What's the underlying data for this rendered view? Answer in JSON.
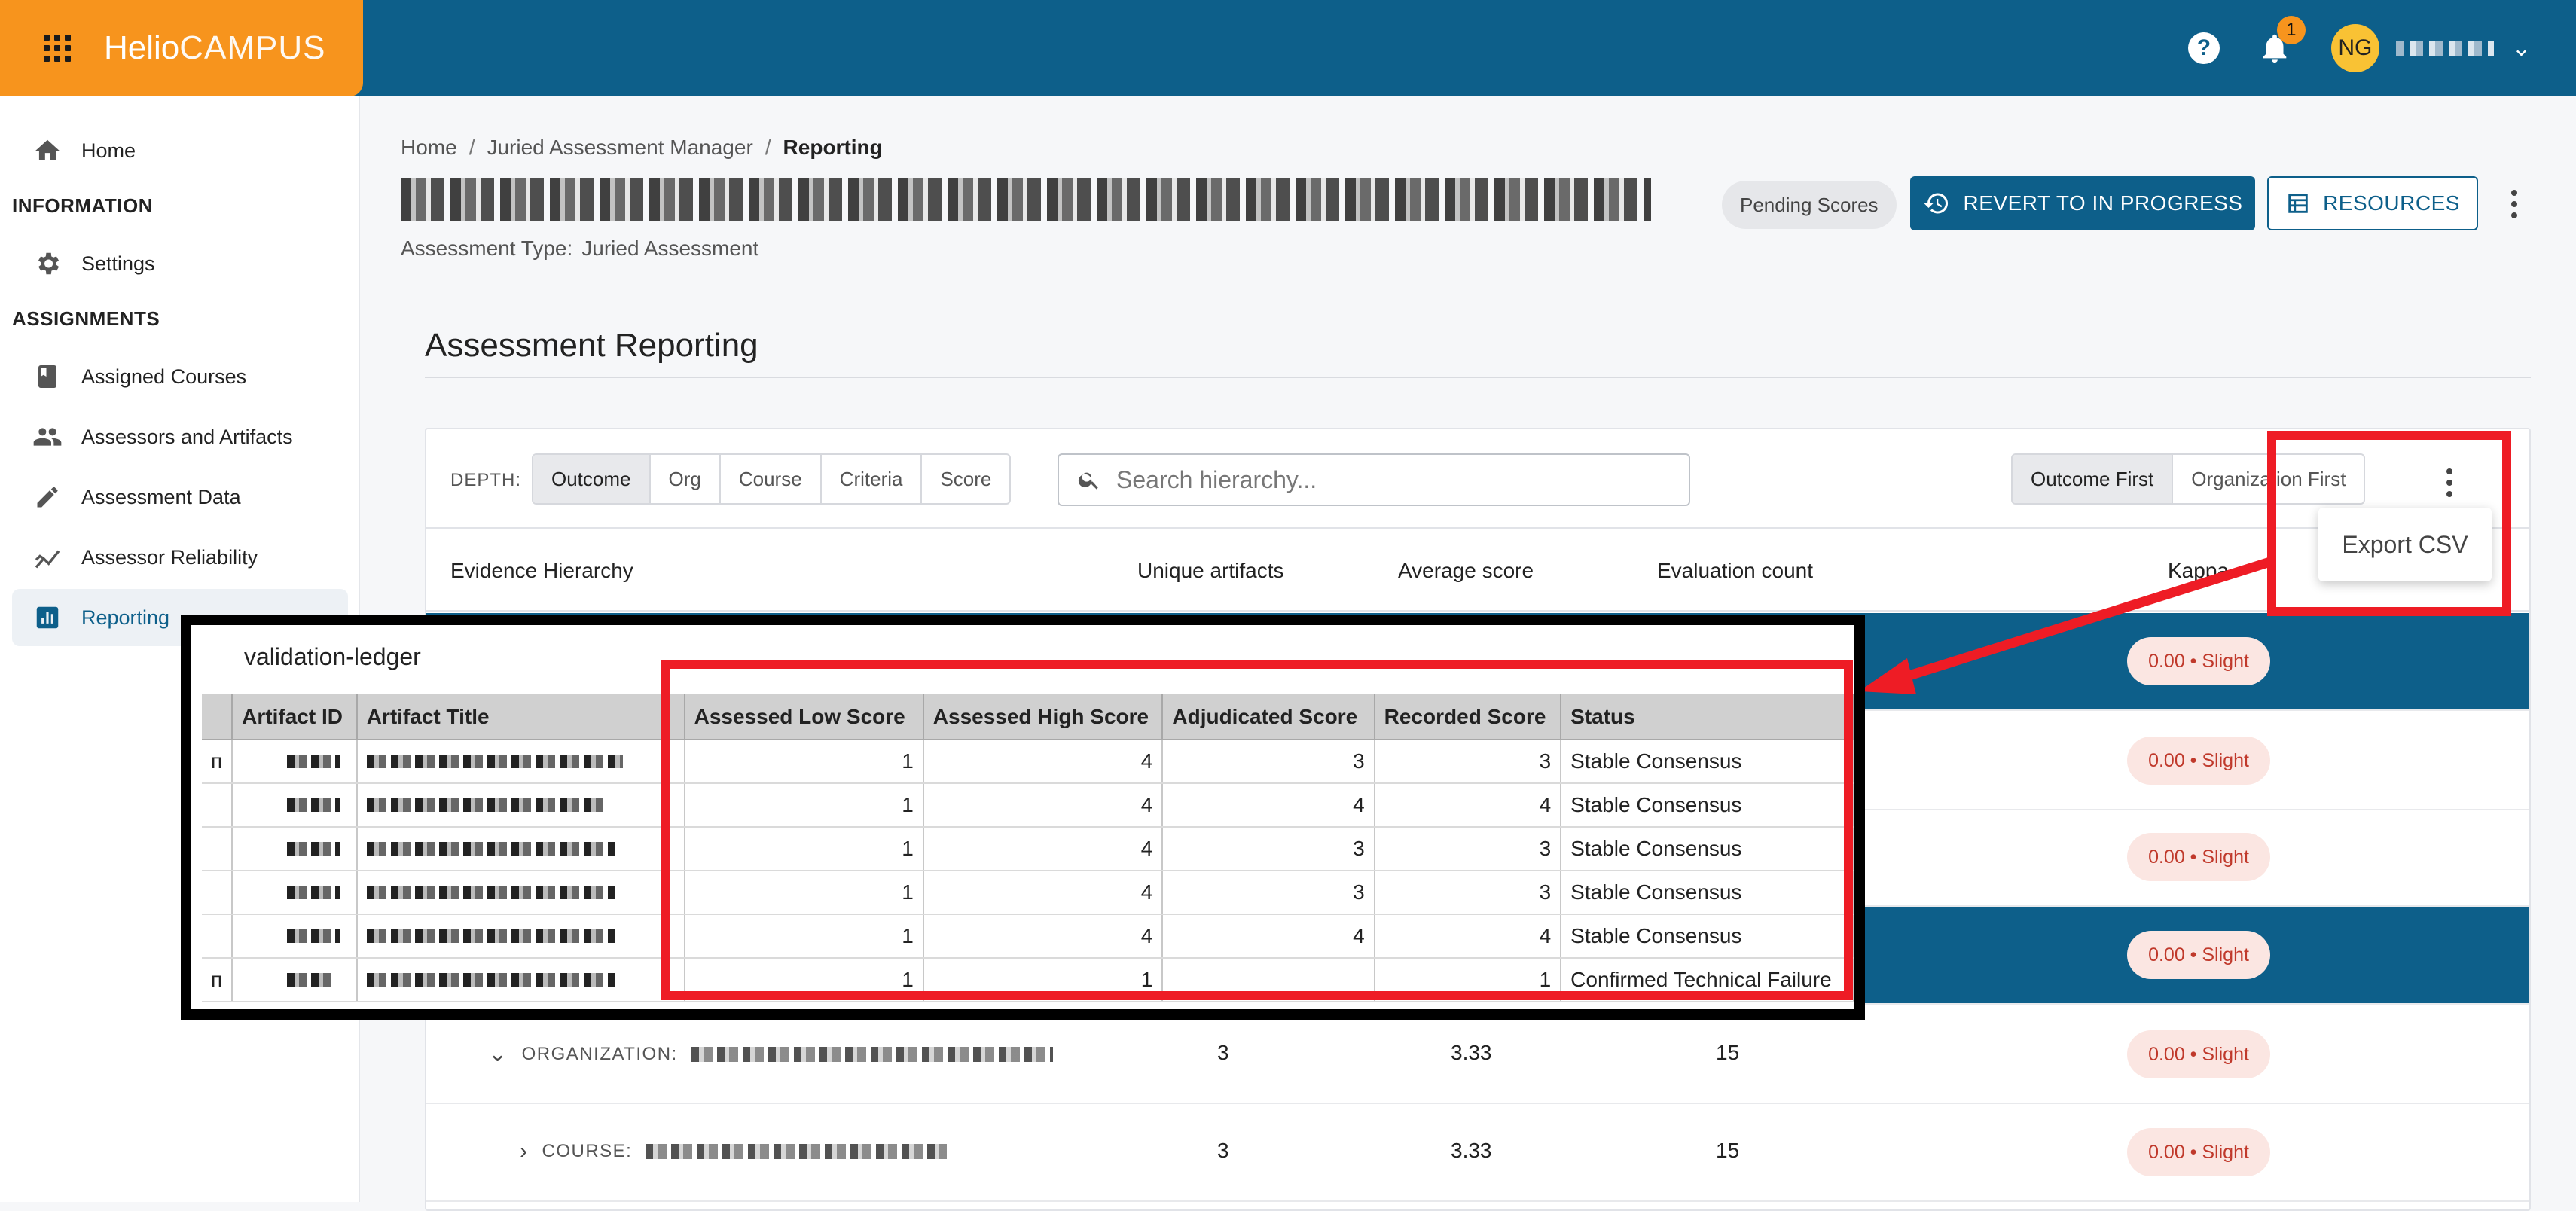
{
  "app": {
    "brand_left": "Helio",
    "brand_right": "CAMPUS",
    "notifications_count": "1",
    "user_initials": "NG"
  },
  "sidebar": {
    "items": [
      {
        "label": "Home",
        "icon": "home-icon"
      },
      {
        "label": "Settings",
        "icon": "gear-icon"
      },
      {
        "label": "Assigned Courses",
        "icon": "book-icon"
      },
      {
        "label": "Assessors and Artifacts",
        "icon": "people-icon"
      },
      {
        "label": "Assessment Data",
        "icon": "pencil-icon"
      },
      {
        "label": "Assessor Reliability",
        "icon": "chart-line-icon"
      },
      {
        "label": "Reporting",
        "icon": "report-icon"
      }
    ],
    "headings": [
      "INFORMATION",
      "ASSIGNMENTS"
    ]
  },
  "breadcrumb": [
    "Home",
    "Juried Assessment Manager",
    "Reporting"
  ],
  "header": {
    "assessment_type_label": "Assessment Type:",
    "assessment_type_value": "Juried Assessment",
    "status_chip": "Pending Scores",
    "revert_button": "REVERT TO IN PROGRESS",
    "resources_button": "RESOURCES"
  },
  "reporting": {
    "title": "Assessment Reporting",
    "depth_label": "DEPTH:",
    "depth_options": [
      "Outcome",
      "Org",
      "Course",
      "Criteria",
      "Score"
    ],
    "depth_selected": "Outcome",
    "search_placeholder": "Search hierarchy...",
    "order_options": [
      "Outcome First",
      "Organization First"
    ],
    "export_menu_item": "Export CSV",
    "columns": [
      "Evidence Hierarchy",
      "Unique artifacts",
      "Average score",
      "Evaluation count",
      "Kappa"
    ],
    "rows": [
      {
        "kappa": "0.00 • Slight"
      },
      {
        "kappa": "0.00 • Slight"
      },
      {
        "kappa": "0.00 • Slight"
      },
      {
        "kappa": "0.00 • Slight"
      },
      {
        "level": "ORGANIZATION:",
        "unique": "3",
        "avg": "3.33",
        "count": "15",
        "kappa": "0.00 • Slight"
      },
      {
        "level": "COURSE:",
        "unique": "3",
        "avg": "3.33",
        "count": "15",
        "kappa": "0.00 • Slight"
      }
    ]
  },
  "ledger": {
    "title": "validation-ledger",
    "columns": [
      "Artifact ID",
      "Artifact Title",
      "Assessed Low Score",
      "Assessed High Score",
      "Adjudicated Score",
      "Recorded Score",
      "Status"
    ],
    "rows": [
      {
        "low": "1",
        "high": "4",
        "adj": "3",
        "rec": "3",
        "status": "Stable Consensus"
      },
      {
        "low": "1",
        "high": "4",
        "adj": "4",
        "rec": "4",
        "status": "Stable Consensus"
      },
      {
        "low": "1",
        "high": "4",
        "adj": "3",
        "rec": "3",
        "status": "Stable Consensus"
      },
      {
        "low": "1",
        "high": "4",
        "adj": "3",
        "rec": "3",
        "status": "Stable Consensus"
      },
      {
        "low": "1",
        "high": "4",
        "adj": "4",
        "rec": "4",
        "status": "Stable Consensus"
      },
      {
        "low": "1",
        "high": "1",
        "adj": "",
        "rec": "1",
        "status": "Confirmed Technical Failure"
      }
    ],
    "left_marks": [
      "п",
      "п"
    ]
  },
  "colors": {
    "brand_orange": "#f7941d",
    "topbar_blue": "#0d5f8a",
    "annotation_red": "#ee1c25",
    "kappa_bg": "#fbe6e2",
    "kappa_text": "#c0392b"
  }
}
